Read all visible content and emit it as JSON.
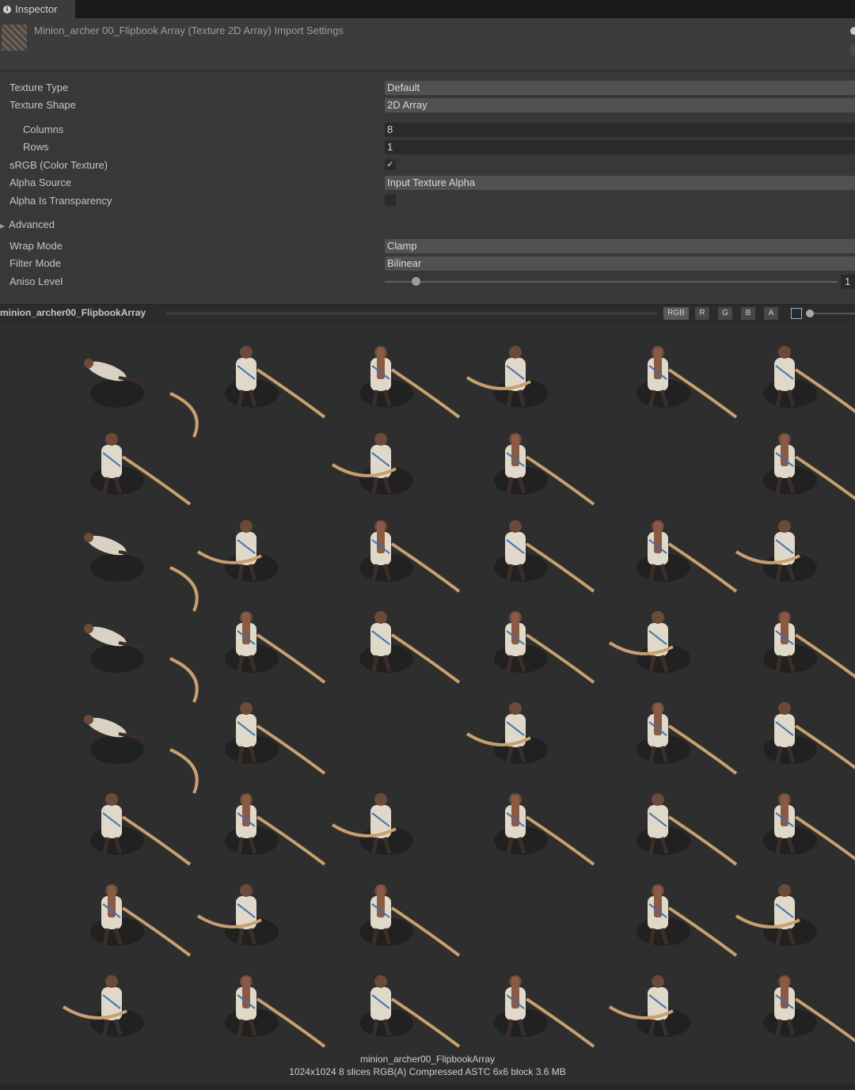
{
  "tab": {
    "label": "Inspector"
  },
  "header": {
    "title": "Minion_archer 00_Flipbook Array (Texture 2D Array) Import Settings"
  },
  "settings": {
    "texture_type": {
      "label": "Texture Type",
      "value": "Default"
    },
    "texture_shape": {
      "label": "Texture Shape",
      "value": "2D Array"
    },
    "columns": {
      "label": "Columns",
      "value": "8"
    },
    "rows": {
      "label": "Rows",
      "value": "1"
    },
    "srgb": {
      "label": "sRGB (Color Texture)",
      "checked": true,
      "mark": "✓"
    },
    "alpha_source": {
      "label": "Alpha Source",
      "value": "Input Texture Alpha"
    },
    "alpha_is_transparency": {
      "label": "Alpha Is Transparency",
      "checked": false
    },
    "advanced": {
      "label": "Advanced",
      "arrow": "▶"
    },
    "wrap_mode": {
      "label": "Wrap Mode",
      "value": "Clamp"
    },
    "filter_mode": {
      "label": "Filter Mode",
      "value": "Bilinear"
    },
    "aniso_level": {
      "label": "Aniso Level",
      "value": "1"
    }
  },
  "preview": {
    "name": "minion_archer00_FlipbookArray",
    "channels": [
      "RGB",
      "R",
      "G",
      "B",
      "A"
    ],
    "active_channel": "RGB",
    "caption_name": "minion_archer00_FlipbookArray",
    "caption_info": "1024x1024 8 slices RGB(A) Compressed ASTC 6x6 block 3.6 MB"
  },
  "colors": {
    "background": "#383838",
    "preview_bg": "#2e2e2e",
    "field": "#515151"
  }
}
